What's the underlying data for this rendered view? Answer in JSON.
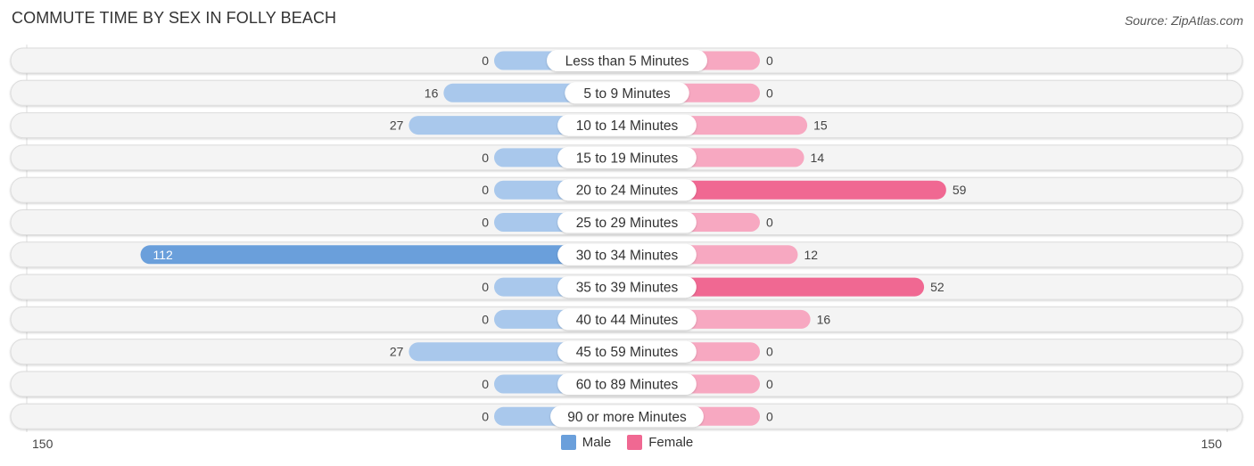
{
  "chart_data": {
    "type": "bar",
    "orientation": "horizontal-diverging",
    "title": "COMMUTE TIME BY SEX IN FOLLY BEACH",
    "source": "Source: ZipAtlas.com",
    "categories": [
      "Less than 5 Minutes",
      "5 to 9 Minutes",
      "10 to 14 Minutes",
      "15 to 19 Minutes",
      "20 to 24 Minutes",
      "25 to 29 Minutes",
      "30 to 34 Minutes",
      "35 to 39 Minutes",
      "40 to 44 Minutes",
      "45 to 59 Minutes",
      "60 to 89 Minutes",
      "90 or more Minutes"
    ],
    "series": [
      {
        "name": "Male",
        "color": "#6a9fdb",
        "light_color": "#a9c8ec",
        "values": [
          0,
          16,
          27,
          0,
          0,
          0,
          112,
          0,
          0,
          27,
          0,
          0
        ]
      },
      {
        "name": "Female",
        "color": "#f06892",
        "light_color": "#f7a8c1",
        "values": [
          0,
          0,
          15,
          14,
          59,
          0,
          12,
          52,
          16,
          0,
          0,
          0
        ]
      }
    ],
    "axis": {
      "left_label": "150",
      "right_label": "150",
      "xlim": [
        -150,
        150
      ]
    },
    "legend": {
      "position": "bottom-center"
    }
  }
}
